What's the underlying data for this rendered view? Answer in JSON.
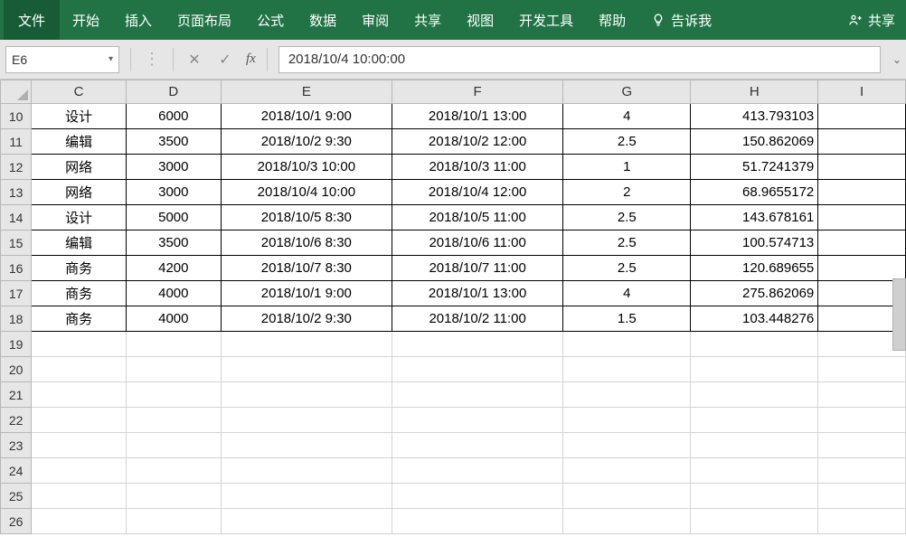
{
  "ribbon": {
    "file": "文件",
    "tabs": [
      "开始",
      "插入",
      "页面布局",
      "公式",
      "数据",
      "审阅",
      "共享",
      "视图",
      "开发工具",
      "帮助"
    ],
    "tell_me": "告诉我",
    "share": "共享"
  },
  "formula_bar": {
    "name_box": "E6",
    "fx_label": "fx",
    "value": "2018/10/4  10:00:00"
  },
  "columns": [
    "C",
    "D",
    "E",
    "F",
    "G",
    "H",
    "I"
  ],
  "row_start": 10,
  "row_end": 26,
  "rows": [
    {
      "C": "设计",
      "D": "6000",
      "E": "2018/10/1 9:00",
      "F": "2018/10/1 13:00",
      "G": "4",
      "H": "413.793103"
    },
    {
      "C": "编辑",
      "D": "3500",
      "E": "2018/10/2 9:30",
      "F": "2018/10/2 12:00",
      "G": "2.5",
      "H": "150.862069"
    },
    {
      "C": "网络",
      "D": "3000",
      "E": "2018/10/3 10:00",
      "F": "2018/10/3 11:00",
      "G": "1",
      "H": "51.7241379"
    },
    {
      "C": "网络",
      "D": "3000",
      "E": "2018/10/4 10:00",
      "F": "2018/10/4 12:00",
      "G": "2",
      "H": "68.9655172"
    },
    {
      "C": "设计",
      "D": "5000",
      "E": "2018/10/5 8:30",
      "F": "2018/10/5 11:00",
      "G": "2.5",
      "H": "143.678161"
    },
    {
      "C": "编辑",
      "D": "3500",
      "E": "2018/10/6 8:30",
      "F": "2018/10/6 11:00",
      "G": "2.5",
      "H": "100.574713"
    },
    {
      "C": "商务",
      "D": "4200",
      "E": "2018/10/7 8:30",
      "F": "2018/10/7 11:00",
      "G": "2.5",
      "H": "120.689655"
    },
    {
      "C": "商务",
      "D": "4000",
      "E": "2018/10/1 9:00",
      "F": "2018/10/1 13:00",
      "G": "4",
      "H": "275.862069"
    },
    {
      "C": "商务",
      "D": "4000",
      "E": "2018/10/2 9:30",
      "F": "2018/10/2 11:00",
      "G": "1.5",
      "H": "103.448276"
    }
  ]
}
